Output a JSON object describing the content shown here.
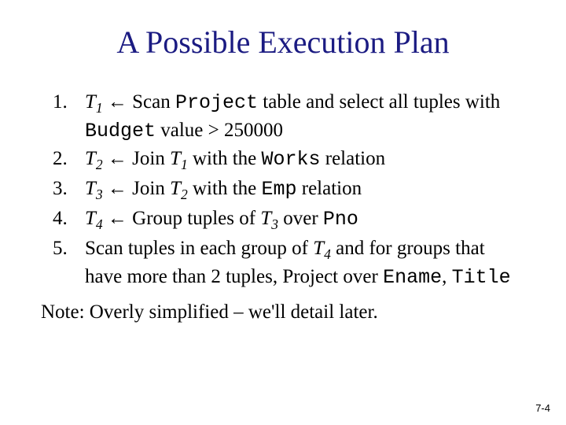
{
  "title": "A Possible Execution Plan",
  "steps": {
    "s1": {
      "var": "T",
      "sub": "1",
      "pre": " Scan ",
      "code1": "Project",
      "mid1": " table and select all tuples with ",
      "code2": "Budget",
      "post": " value > 250000"
    },
    "s2": {
      "var": "T",
      "sub": "2",
      "pre": " Join ",
      "var2": "T",
      "sub2": "1",
      "mid": " with the ",
      "code": "Works",
      "post": " relation"
    },
    "s3": {
      "var": "T",
      "sub": "3",
      "pre": " Join ",
      "var2": "T",
      "sub2": "2",
      "mid": " with the ",
      "code": "Emp",
      "post": " relation"
    },
    "s4": {
      "var": "T",
      "sub": "4",
      "pre": " Group tuples of ",
      "var2": "T",
      "sub2": "3",
      "mid": " over ",
      "code": "Pno"
    },
    "s5": {
      "pre": "Scan tuples in each group of ",
      "var": "T",
      "sub": "4",
      "mid": " and for groups that have more than 2 tuples, Project over ",
      "code1": "Ename",
      "sep": ", ",
      "code2": "Title"
    }
  },
  "arrow": "←",
  "note": "Note: Overly simplified – we'll detail later.",
  "pagenum": "7-4"
}
